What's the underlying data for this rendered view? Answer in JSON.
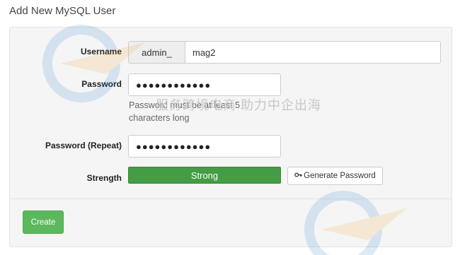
{
  "page": {
    "title": "Add New MySQL User"
  },
  "form": {
    "username": {
      "label": "Username",
      "prefix": "admin_",
      "value": "mag2"
    },
    "password": {
      "label": "Password",
      "value": "●●●●●●●●●●●●",
      "help": "Password must be at least 5 characters long"
    },
    "password_repeat": {
      "label": "Password (Repeat)",
      "value": "●●●●●●●●●●●●"
    },
    "strength": {
      "label": "Strength",
      "value": "Strong"
    },
    "generate_button": {
      "label": "Generate Password",
      "icon": "key-icon"
    },
    "create_button": {
      "label": "Create"
    }
  },
  "colors": {
    "strength_bar": "#449d44",
    "create_button": "#5cb85c",
    "watermark": "#2f7fd0"
  },
  "watermark": {
    "text": "服务跨境电商 助力中企出海"
  }
}
